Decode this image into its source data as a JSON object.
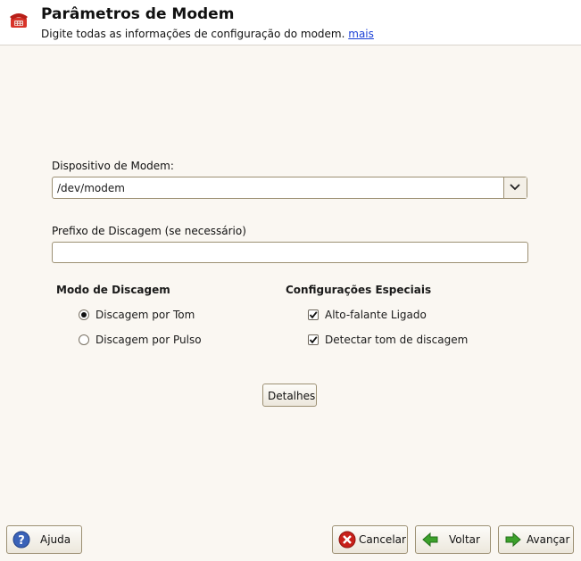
{
  "header": {
    "title": "Parâmetros de Modem",
    "subtitle": "Digite todas as informações de configuração do modem.",
    "more_link": "mais",
    "icon": "phone-icon"
  },
  "device": {
    "label": "Dispositivo de Modem:",
    "value": "/dev/modem"
  },
  "prefix": {
    "label": "Prefixo de Discagem (se necessário)",
    "value": ""
  },
  "dial_mode": {
    "title": "Modo de Discagem",
    "options": [
      {
        "label": "Discagem por Tom",
        "selected": true
      },
      {
        "label": "Discagem por Pulso",
        "selected": false
      }
    ]
  },
  "special": {
    "title": "Configurações Especiais",
    "options": [
      {
        "label": "Alto-falante Ligado",
        "checked": true
      },
      {
        "label": "Detectar tom de discagem",
        "checked": true
      }
    ]
  },
  "details_button": "Detalhes",
  "footer": {
    "help": "Ajuda",
    "cancel": "Cancelar",
    "back": "Voltar",
    "next": "Avançar"
  },
  "colors": {
    "background": "#faf7f2",
    "link": "#1a3fd6",
    "cancel_icon": "#c8201a",
    "nav_icon": "#3ca12b",
    "help_icon": "#3a62b8"
  }
}
